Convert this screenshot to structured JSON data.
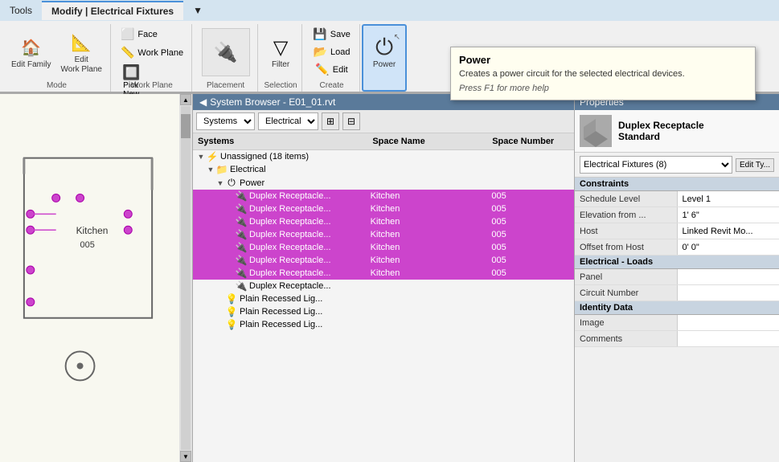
{
  "ribbon": {
    "tabs": [
      {
        "label": "Tools",
        "active": false
      },
      {
        "label": "Modify | Electrical Fixtures",
        "active": true
      },
      {
        "label": "▼",
        "active": false
      }
    ],
    "groups": {
      "mode": {
        "label": "Mode",
        "buttons": [
          {
            "id": "edit-family",
            "icon": "🏠",
            "label": "Edit\nFamily"
          },
          {
            "id": "edit-work-plane",
            "icon": "📐",
            "label": "Edit\nWork Plane"
          }
        ]
      },
      "workplane": {
        "label": "Work Plane",
        "buttons": [
          {
            "id": "face",
            "icon": "⬜",
            "label": "Face"
          },
          {
            "id": "work-plane",
            "icon": "📏",
            "label": "Work Plane"
          },
          {
            "id": "pick-new",
            "icon": "🔲",
            "label": "Pick\nNew"
          }
        ]
      },
      "placement": {
        "label": "Placement",
        "buttons": [
          {
            "id": "placement",
            "icon": "⬜",
            "label": ""
          }
        ]
      },
      "filter": {
        "label": "",
        "buttons": [
          {
            "id": "filter",
            "icon": "▽",
            "label": "Filter"
          }
        ]
      },
      "create": {
        "label": "Create",
        "buttons": [
          {
            "id": "save",
            "icon": "💾",
            "label": "Save"
          },
          {
            "id": "load",
            "icon": "📂",
            "label": "Load"
          },
          {
            "id": "edit",
            "icon": "✏️",
            "label": "Edit"
          }
        ]
      },
      "power": {
        "label": "",
        "buttons": [
          {
            "id": "power",
            "icon": "⏻",
            "label": "Power"
          }
        ]
      }
    },
    "section_labels": [
      "Mode",
      "Work Plane",
      "Placement",
      "Selection",
      "Create"
    ]
  },
  "tooltip": {
    "title": "Power",
    "description": "Creates a power circuit for the selected electrical devices.",
    "help_text": "Press F1 for more help"
  },
  "system_browser": {
    "title": "System Browser - E01_01.rvt",
    "dropdown1": "Systems",
    "dropdown2": "Electrical",
    "columns": [
      "Systems",
      "Space Name",
      "Space Number"
    ],
    "tree": [
      {
        "id": "unassigned",
        "indent": 0,
        "toggle": "▼",
        "icon": "⚡",
        "label": "Unassigned (18 items)",
        "selected": false
      },
      {
        "id": "electrical",
        "indent": 1,
        "toggle": "▼",
        "icon": "📁",
        "label": "Electrical",
        "selected": false
      },
      {
        "id": "power",
        "indent": 2,
        "toggle": "▼",
        "icon": "⏻",
        "label": "Power",
        "selected": false
      },
      {
        "id": "row1",
        "indent": 3,
        "toggle": "",
        "icon": "🔌",
        "label": "Duplex Receptacle...",
        "space": "Kitchen",
        "number": "005",
        "selected": true
      },
      {
        "id": "row2",
        "indent": 3,
        "toggle": "",
        "icon": "🔌",
        "label": "Duplex Receptacle...",
        "space": "Kitchen",
        "number": "005",
        "selected": true
      },
      {
        "id": "row3",
        "indent": 3,
        "toggle": "",
        "icon": "🔌",
        "label": "Duplex Receptacle...",
        "space": "Kitchen",
        "number": "005",
        "selected": true
      },
      {
        "id": "row4",
        "indent": 3,
        "toggle": "",
        "icon": "🔌",
        "label": "Duplex Receptacle...",
        "space": "Kitchen",
        "number": "005",
        "selected": true
      },
      {
        "id": "row5",
        "indent": 3,
        "toggle": "",
        "icon": "🔌",
        "label": "Duplex Receptacle...",
        "space": "Kitchen",
        "number": "005",
        "selected": true
      },
      {
        "id": "row6",
        "indent": 3,
        "toggle": "",
        "icon": "🔌",
        "label": "Duplex Receptacle...",
        "space": "Kitchen",
        "number": "005",
        "selected": true
      },
      {
        "id": "row7",
        "indent": 3,
        "toggle": "",
        "icon": "🔌",
        "label": "Duplex Receptacle...",
        "space": "Kitchen",
        "number": "005",
        "selected": true
      },
      {
        "id": "row8",
        "indent": 3,
        "toggle": "",
        "icon": "🔌",
        "label": "Duplex Receptacle...",
        "selected": false
      },
      {
        "id": "row9",
        "indent": 2,
        "toggle": "",
        "icon": "💡",
        "label": "Plain Recessed Lig...",
        "selected": false
      },
      {
        "id": "row10",
        "indent": 2,
        "toggle": "",
        "icon": "💡",
        "label": "Plain Recessed Lig...",
        "selected": false
      },
      {
        "id": "row11",
        "indent": 2,
        "toggle": "",
        "icon": "💡",
        "label": "Plain Recessed Lig...",
        "selected": false
      }
    ]
  },
  "properties": {
    "header": "Properties",
    "object_name": "Duplex Receptacle\nStandard",
    "type_selector": "Electrical Fixtures (8)",
    "edit_type_btn": "Edit Ty...",
    "sections": [
      {
        "id": "constraints",
        "label": "Constraints",
        "rows": [
          {
            "key": "Schedule Level",
            "value": "Level 1"
          },
          {
            "key": "Elevation from ...",
            "value": "1' 6\""
          },
          {
            "key": "Host",
            "value": "Linked Revit Mo..."
          },
          {
            "key": "Offset from Host",
            "value": "0' 0\""
          }
        ]
      },
      {
        "id": "electrical-loads",
        "label": "Electrical - Loads",
        "rows": [
          {
            "key": "Panel",
            "value": ""
          },
          {
            "key": "Circuit Number",
            "value": ""
          }
        ]
      },
      {
        "id": "identity-data",
        "label": "Identity Data",
        "rows": [
          {
            "key": "Image",
            "value": ""
          },
          {
            "key": "Comments",
            "value": ""
          }
        ]
      }
    ]
  },
  "floor_plan": {
    "room_label": "Kitchen",
    "room_number": "005"
  }
}
